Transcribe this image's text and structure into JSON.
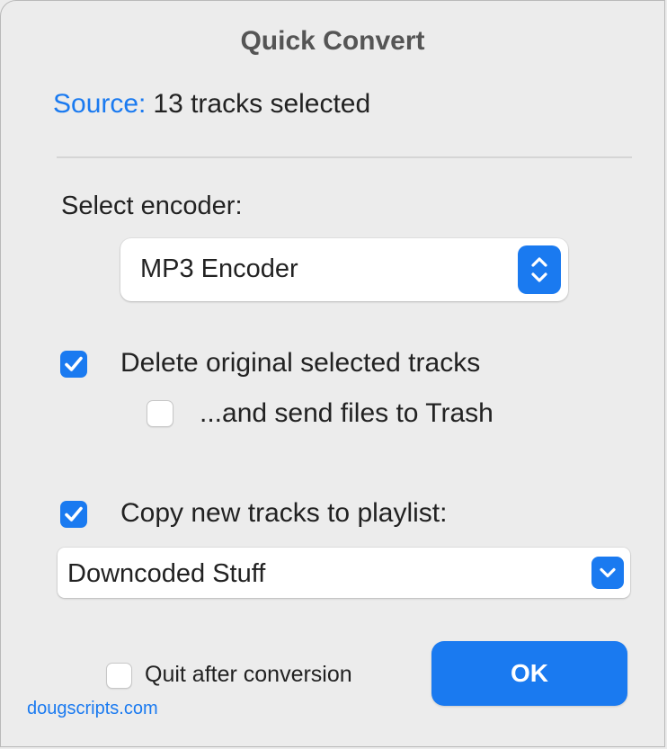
{
  "dialog": {
    "title": "Quick Convert"
  },
  "source": {
    "label": "Source:",
    "value": "13 tracks selected"
  },
  "encoder": {
    "label": "Select encoder:",
    "selected": "MP3 Encoder"
  },
  "options": {
    "delete_originals": {
      "label": "Delete original selected tracks",
      "checked": true
    },
    "send_to_trash": {
      "label": "...and send files to Trash",
      "checked": false
    },
    "copy_to_playlist": {
      "label": "Copy new tracks to playlist:",
      "checked": true
    }
  },
  "playlist": {
    "selected": "Downcoded Stuff"
  },
  "footer": {
    "quit_after": {
      "label": "Quit after conversion",
      "checked": false
    },
    "ok_label": "OK",
    "link": "dougscripts.com"
  },
  "colors": {
    "accent": "#1a7af0",
    "background": "#ececec",
    "text": "#222222",
    "title_text": "#555555"
  },
  "icons": {
    "encoder_stepper": "up-down-chevron-icon",
    "playlist_dropdown": "chevron-down-icon",
    "checkmark": "checkmark-icon"
  }
}
